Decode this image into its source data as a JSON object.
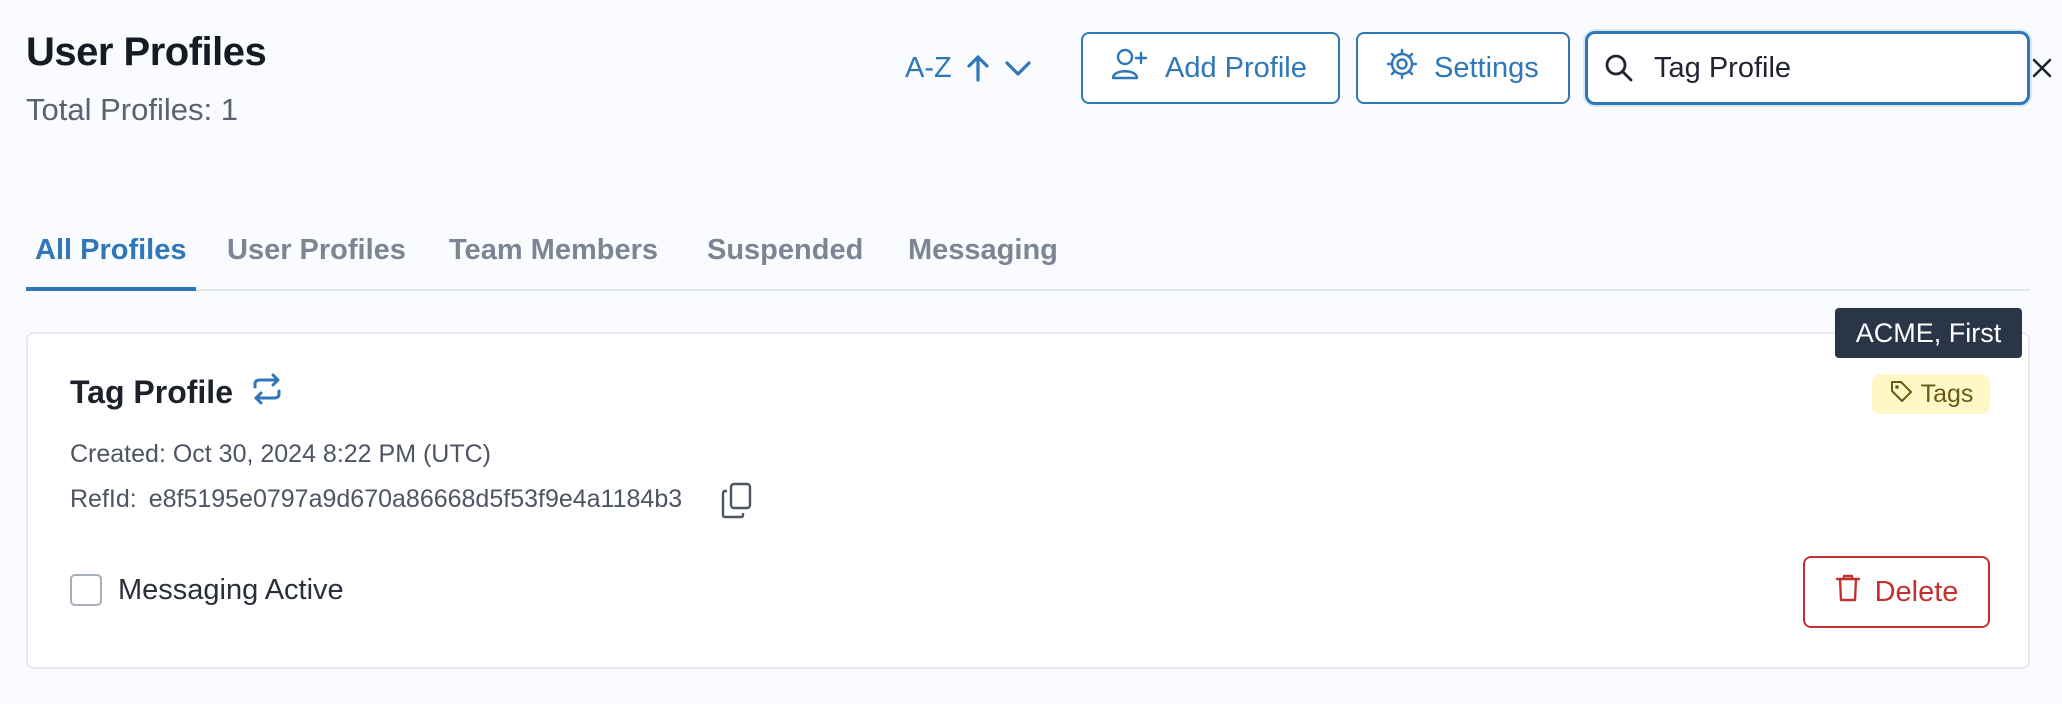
{
  "header": {
    "title": "User Profiles",
    "total_label": "Total Profiles: 1"
  },
  "toolbar": {
    "sort_label": "A-Z",
    "add_label": "Add Profile",
    "settings_label": "Settings"
  },
  "search": {
    "value": "Tag Profile",
    "placeholder": ""
  },
  "tabs": [
    {
      "label": "All Profiles",
      "active": true
    },
    {
      "label": "User Profiles",
      "active": false
    },
    {
      "label": "Team Members",
      "active": false
    },
    {
      "label": "Suspended",
      "active": false
    },
    {
      "label": "Messaging",
      "active": false
    }
  ],
  "profile": {
    "name": "Tag Profile",
    "created": "Created: Oct 30, 2024 8:22 PM (UTC)",
    "refid_label": "RefId:",
    "refid_value": "e8f5195e0797a9d670a86668d5f53f9e4a1184b3",
    "messaging_label": "Messaging Active",
    "messaging_checked": false,
    "tags_label": "Tags",
    "tags_tooltip": "ACME, First",
    "delete_label": "Delete"
  },
  "colors": {
    "accent": "#2f77b8",
    "danger": "#c53030",
    "tag_bg": "#fdf8c6",
    "tooltip_bg": "#2a3547"
  },
  "icons": {
    "sort": [
      "arrow-up-icon",
      "chevron-down-icon"
    ],
    "add": "user-plus-icon",
    "settings": "gear-icon",
    "search": "search-icon",
    "clear": "close-icon",
    "sync": "sync-icon",
    "copy": "copy-icon",
    "tag": "tag-icon",
    "delete": "trash-icon"
  }
}
